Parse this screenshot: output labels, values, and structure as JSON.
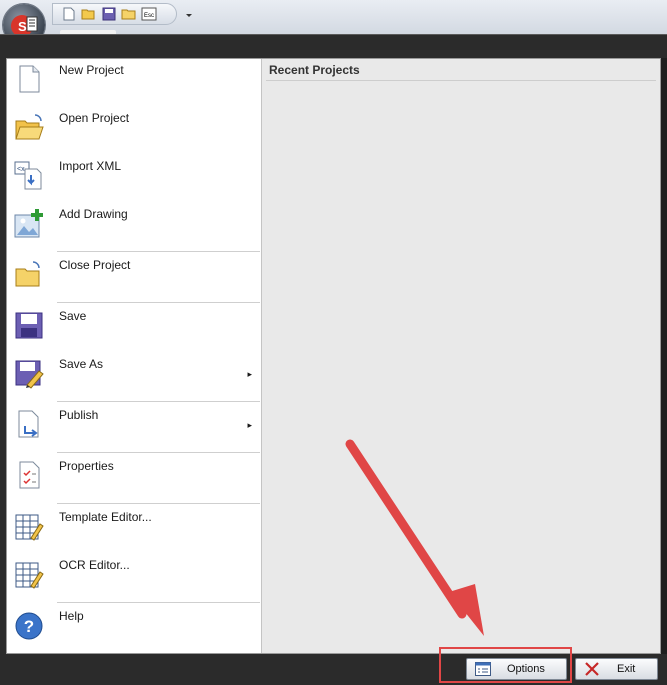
{
  "quick_access": {
    "buttons": [
      "new-icon",
      "open-icon",
      "save-icon",
      "folder-icon",
      "esc-icon"
    ],
    "esc_label": "Esc"
  },
  "menu": {
    "items": [
      {
        "label": "New Project",
        "icon": "new-document-icon",
        "has_arrow": false
      },
      {
        "label": "Open Project",
        "icon": "open-folder-icon",
        "has_arrow": false
      },
      {
        "label": "Import XML",
        "icon": "import-xml-icon",
        "has_arrow": false
      },
      {
        "label": "Add Drawing",
        "icon": "add-drawing-icon",
        "has_arrow": false
      },
      {
        "label": "Close Project",
        "icon": "close-folder-icon",
        "has_arrow": false
      },
      {
        "label": "Save",
        "icon": "save-disk-icon",
        "has_arrow": false
      },
      {
        "label": "Save As",
        "icon": "save-as-icon",
        "has_arrow": true
      },
      {
        "label": "Publish",
        "icon": "publish-icon",
        "has_arrow": true
      },
      {
        "label": "Properties",
        "icon": "properties-icon",
        "has_arrow": false
      },
      {
        "label": "Template Editor...",
        "icon": "template-editor-icon",
        "has_arrow": false
      },
      {
        "label": "OCR Editor...",
        "icon": "ocr-editor-icon",
        "has_arrow": false
      },
      {
        "label": "Help",
        "icon": "help-icon",
        "has_arrow": false
      }
    ],
    "submenu_arrow": "▸"
  },
  "recent": {
    "title": "Recent Projects"
  },
  "footer": {
    "options_label": "Options",
    "exit_label": "Exit"
  },
  "colors": {
    "annotation_red": "#e04646",
    "frame_dark": "#2b2b2b"
  }
}
